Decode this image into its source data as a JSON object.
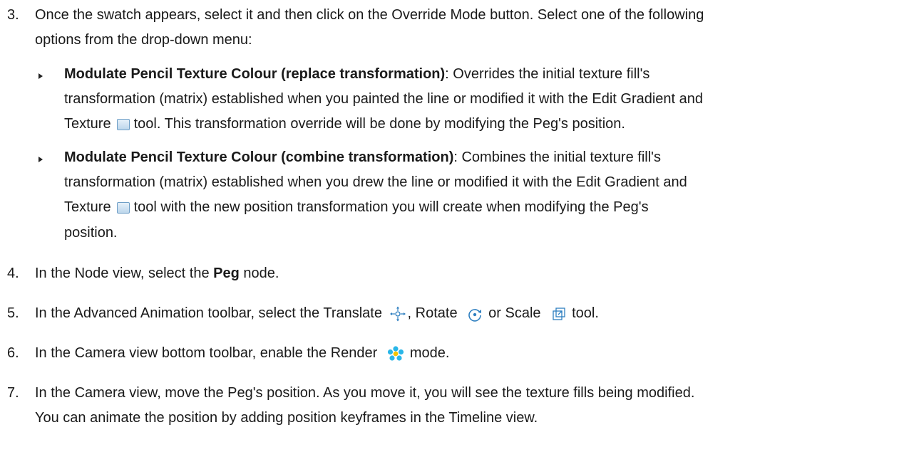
{
  "steps": {
    "s3": {
      "number": "3.",
      "line1": "Once the swatch appears, select it and then click on the Override Mode button. Select one of the following",
      "line2": "options from the drop-down menu:"
    },
    "b1": {
      "title": "Modulate Pencil Texture Colour (replace transformation)",
      "line1_rest": ": Overrides the initial texture fill's",
      "line2": "transformation (matrix) established when you painted the line or modified it with the Edit Gradient and",
      "line3_a": "Texture",
      "line3_b": "tool. This transformation override will be done by modifying the Peg's position."
    },
    "b2": {
      "title": "Modulate Pencil Texture Colour (combine transformation)",
      "line1_rest": ": Combines the initial texture fill's",
      "line2": "transformation (matrix) established when you drew the line or modified it with the Edit Gradient and",
      "line3_a": "Texture",
      "line3_b": "tool with the new position transformation you will create when modifying the Peg's",
      "line4": "position."
    },
    "s4": {
      "number": "4.",
      "a": "In the Node view, select the ",
      "kw": "Peg",
      "b": " node."
    },
    "s5": {
      "number": "5.",
      "a": "In the Advanced Animation toolbar, select the Translate",
      "b": ", Rotate",
      "c": "or Scale",
      "d": "tool."
    },
    "s6": {
      "number": "6.",
      "a": "In the Camera view bottom toolbar, enable the Render",
      "b": "mode."
    },
    "s7": {
      "number": "7.",
      "line1": "In the Camera view, move the Peg's position. As you move it, you will see the texture fills being modified.",
      "line2": "You can animate the position by adding position keyframes in the Timeline view."
    }
  },
  "icons": {
    "texture": "edit-gradient-texture-icon",
    "translate": "translate-icon",
    "rotate": "rotate-icon",
    "scale": "scale-icon",
    "render": "render-icon"
  },
  "colors": {
    "text": "#1a1a1a",
    "icon_blue": "#2e7fc0",
    "render_cyan": "#29b6e8"
  }
}
